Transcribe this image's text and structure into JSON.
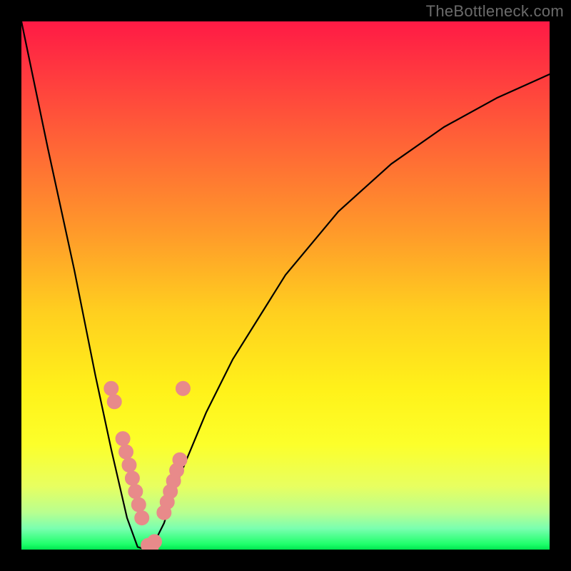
{
  "watermark": "TheBottleneck.com",
  "chart_data": {
    "type": "line",
    "title": "",
    "xlabel": "",
    "ylabel": "",
    "xlim": [
      0,
      100
    ],
    "ylim": [
      0,
      100
    ],
    "background_gradient": {
      "top_color": "#ff1a45",
      "mid_color": "#fff21a",
      "bottom_color": "#00e550"
    },
    "series": [
      {
        "name": "bottleneck-curve",
        "x": [
          0,
          5,
          10,
          14,
          17,
          20,
          22,
          23.5,
          25,
          27,
          30,
          35,
          40,
          50,
          60,
          70,
          80,
          90,
          100
        ],
        "values": [
          100,
          76,
          53,
          33,
          19,
          6,
          0.5,
          0,
          1,
          5,
          14,
          26,
          36,
          52,
          64,
          73,
          80,
          85.5,
          90
        ]
      }
    ],
    "markers": {
      "name": "pink-data-points",
      "color": "#e88a8a",
      "x": [
        17.0,
        17.6,
        19.2,
        19.8,
        20.4,
        21.0,
        21.6,
        22.2,
        22.8,
        24.0,
        24.6,
        25.2,
        27.0,
        27.6,
        28.2,
        28.8,
        29.4,
        30.0,
        30.6
      ],
      "values": [
        30.5,
        28.0,
        21.0,
        18.5,
        16.0,
        13.5,
        11.0,
        8.5,
        6.0,
        0.8,
        0.5,
        1.5,
        7.0,
        9.0,
        11.0,
        13.0,
        15.0,
        17.0,
        30.5
      ]
    }
  }
}
